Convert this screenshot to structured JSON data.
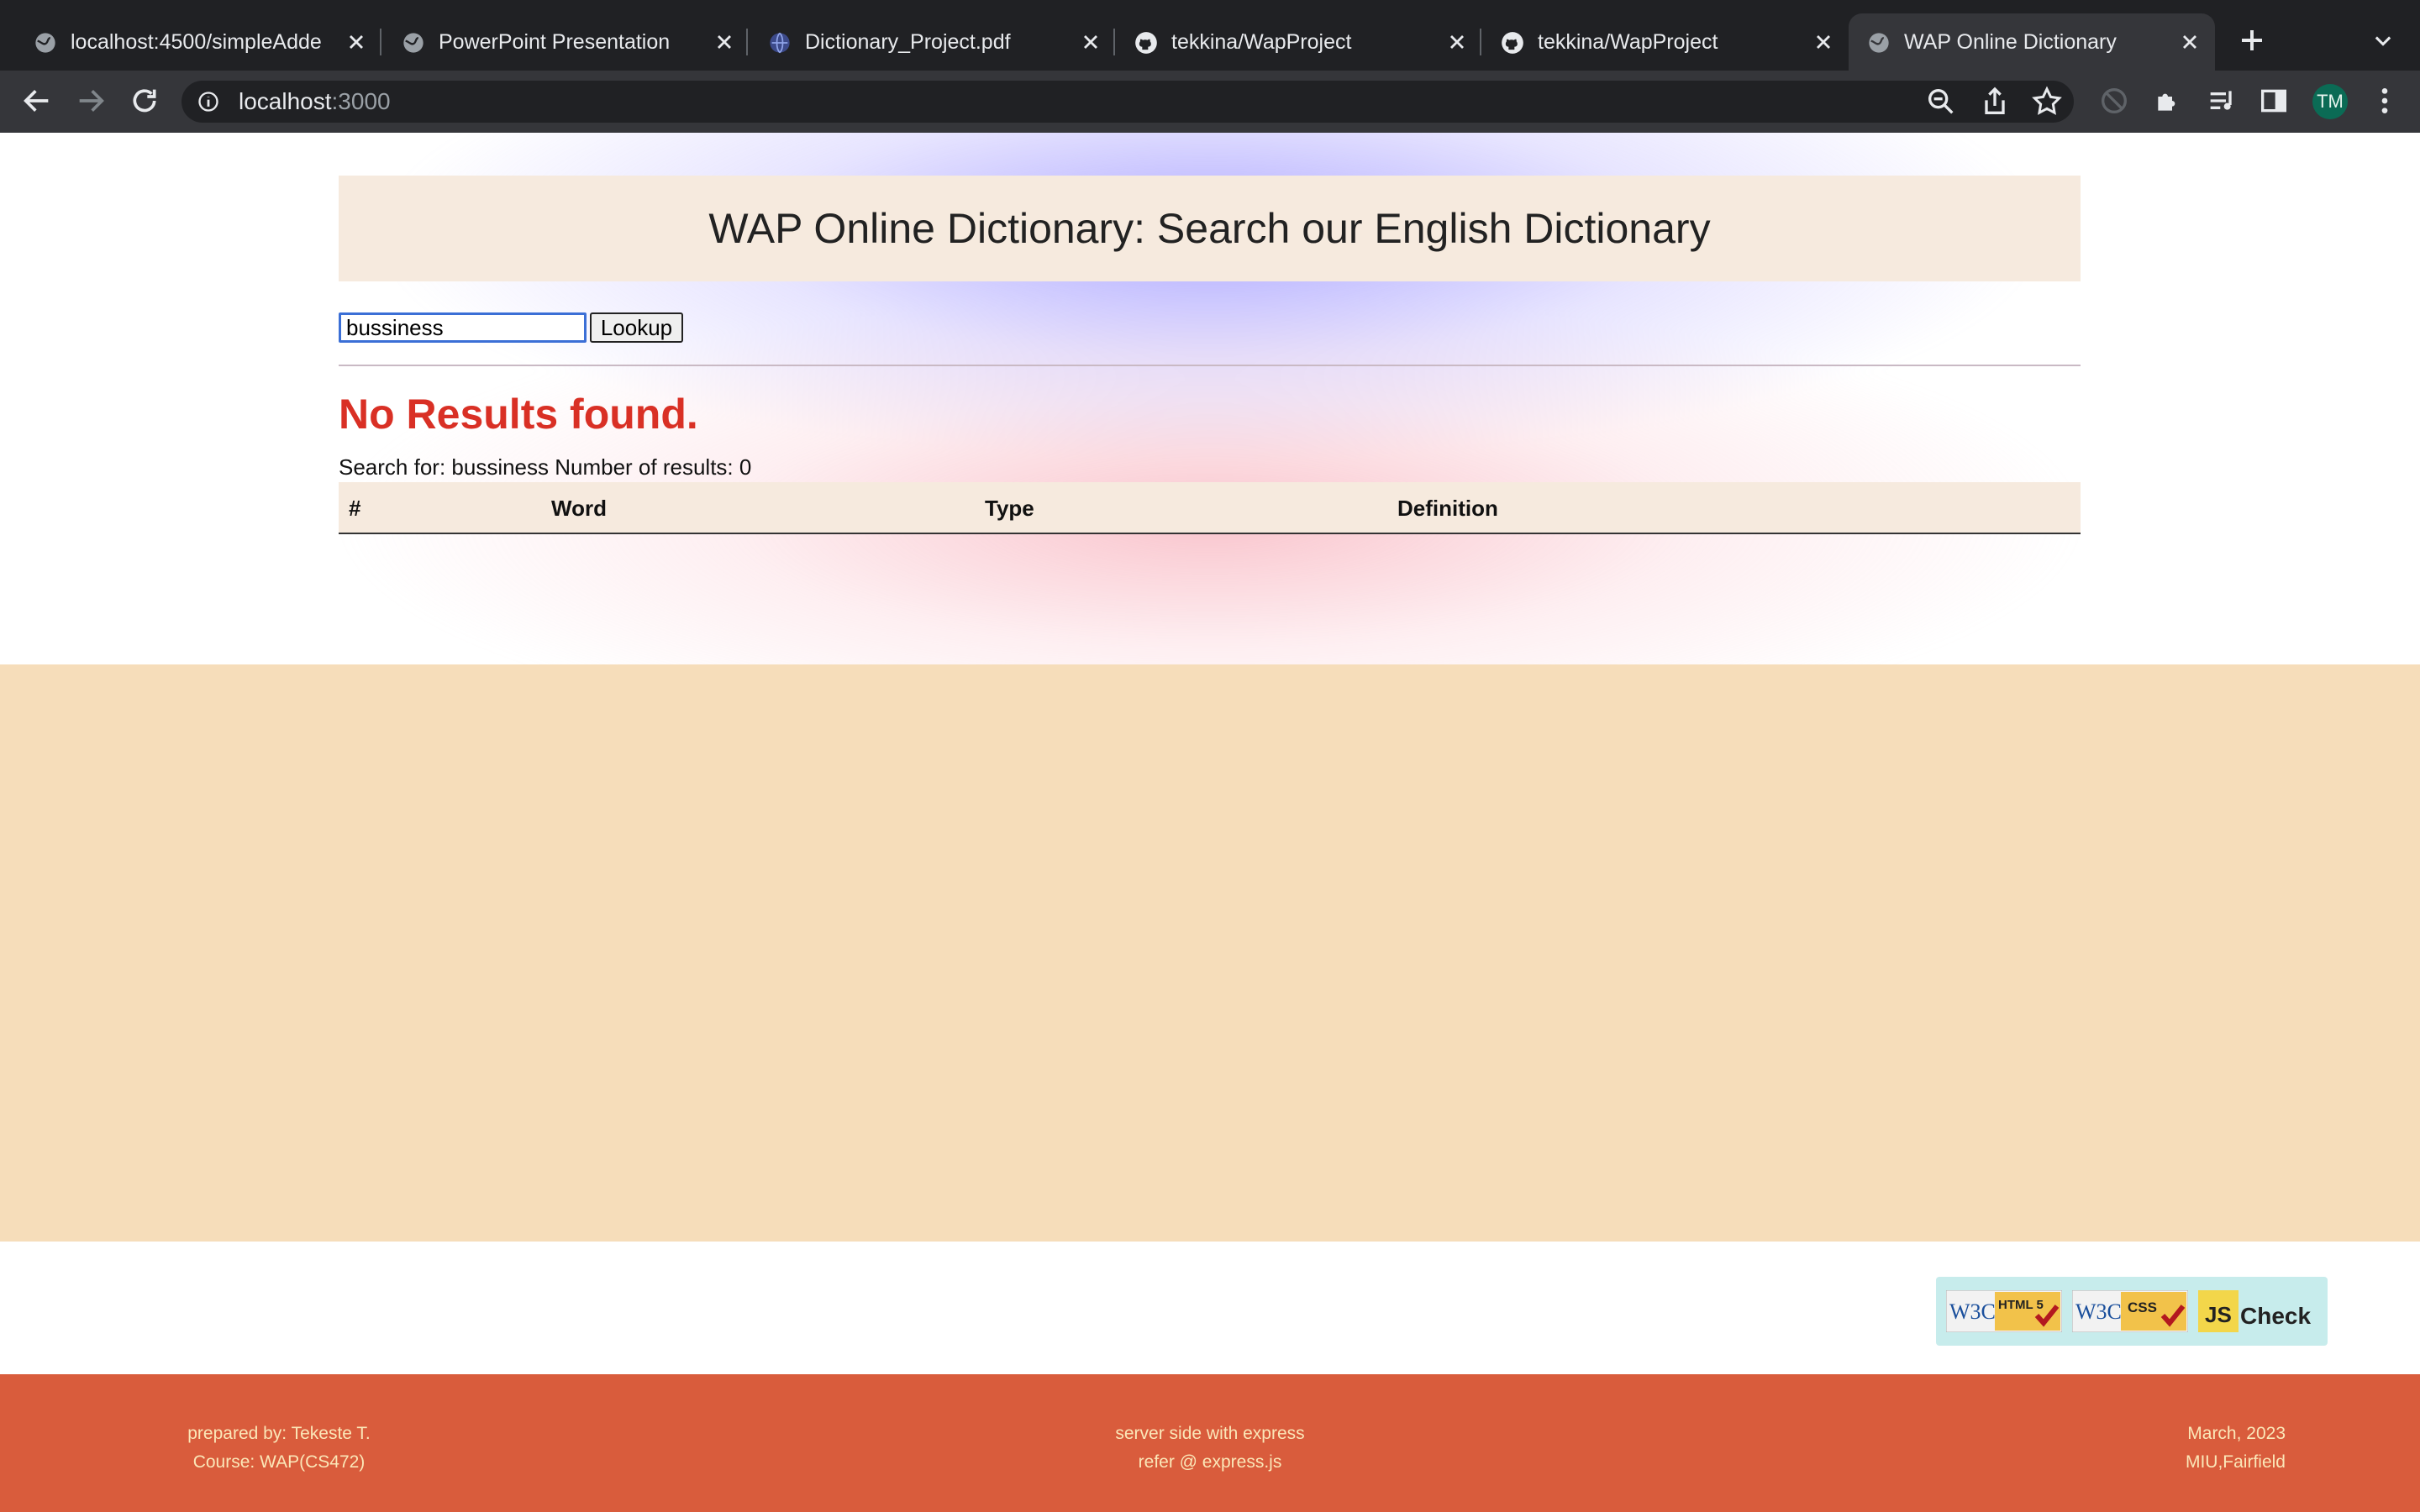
{
  "browser": {
    "tabs": [
      {
        "title": "localhost:4500/simpleAdde",
        "icon": "globe-icon",
        "active": false
      },
      {
        "title": "PowerPoint Presentation",
        "icon": "globe-icon",
        "active": false
      },
      {
        "title": "Dictionary_Project.pdf",
        "icon": "pdf-globe-icon",
        "active": false
      },
      {
        "title": "tekkina/WapProject",
        "icon": "github-icon",
        "active": false
      },
      {
        "title": "tekkina/WapProject",
        "icon": "github-icon",
        "active": false
      },
      {
        "title": "WAP Online Dictionary",
        "icon": "globe-icon",
        "active": true
      }
    ],
    "address": {
      "host": "localhost",
      "port": ":3000"
    },
    "profile_initials": "TM"
  },
  "page": {
    "title": "WAP Online Dictionary: Search our English Dictionary",
    "search": {
      "value": "bussiness",
      "button_label": "Lookup"
    },
    "no_results": "No Results found.",
    "summary": "Search for: bussiness Number of results: 0",
    "table_headers": [
      "#",
      "Word",
      "Type",
      "Definition"
    ]
  },
  "badges": {
    "html": "HTML 5",
    "css": "CSS",
    "js_check": "Check",
    "js": "JS",
    "w3c": "W3C"
  },
  "footer": {
    "left": [
      "prepared by: Tekeste T.",
      "Course: WAP(CS472)"
    ],
    "center": [
      "server side with express",
      "refer @ express.js"
    ],
    "right": [
      "March, 2023",
      "MIU,Fairfield"
    ]
  },
  "colors": {
    "chrome_dark": "#202124",
    "accent_error": "#d93025",
    "header_bg": "#f6eade",
    "sand": "#f6ddba",
    "footer_bg": "#d95c3c",
    "footer_text": "#fbe7b8"
  }
}
